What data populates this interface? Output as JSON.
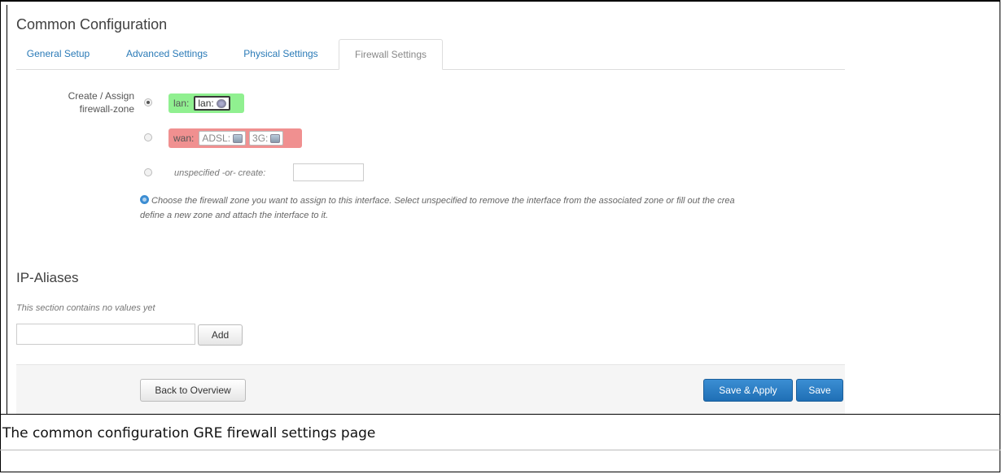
{
  "section": {
    "title": "Common Configuration"
  },
  "tabs": [
    {
      "label": "General Setup",
      "active": false
    },
    {
      "label": "Advanced Settings",
      "active": false
    },
    {
      "label": "Physical Settings",
      "active": false
    },
    {
      "label": "Firewall Settings",
      "active": true
    }
  ],
  "firewall": {
    "label": "Create / Assign firewall-zone",
    "zones": [
      {
        "name": "lan:",
        "networks": [
          "lan:"
        ],
        "selected": true,
        "color": "#90f090"
      },
      {
        "name": "wan:",
        "networks": [
          "ADSL:",
          "3G:"
        ],
        "selected": false,
        "color": "#f09090"
      }
    ],
    "unspecified_label": "unspecified -or- create:",
    "unspecified_value": "",
    "help_line1": "Choose the firewall zone you want to assign to this interface. Select unspecified to remove the interface from the associated zone or fill out the crea",
    "help_line2": "define a new zone and attach the interface to it."
  },
  "ip_aliases": {
    "title": "IP-Aliases",
    "empty_text": "This section contains no values yet",
    "input_value": "",
    "add_label": "Add"
  },
  "footer": {
    "back_label": "Back to Overview",
    "save_apply_label": "Save & Apply",
    "save_label": "Save"
  },
  "caption": "The common configuration GRE firewall settings page",
  "colors": {
    "accent": "#2a7ab7",
    "primary_button": "#2a7fc4",
    "lan_zone": "#90f090",
    "wan_zone": "#f09090"
  }
}
